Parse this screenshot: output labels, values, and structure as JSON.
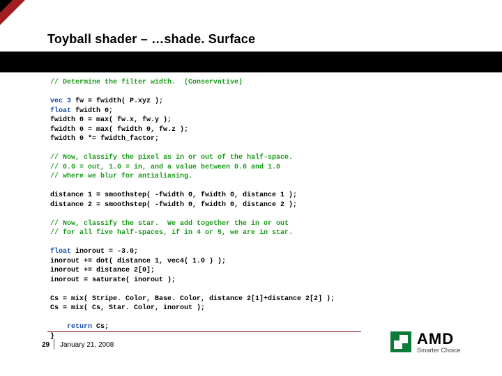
{
  "title": "Toyball shader – …shade. Surface",
  "footer": {
    "page": "29",
    "date": "January 21, 2008"
  },
  "logo": {
    "brand": "AMD",
    "tagline": "Smarter Choice"
  },
  "code": {
    "c1": "// Determine the filter width.  (Conservative)",
    "l1a": "vec 3",
    "l1b": " fw = fwidth( P.xyz );",
    "l2a": "float",
    "l2b": " fwidth 0;",
    "l3": "fwidth 0 = max( fw.x, fw.y );",
    "l4": "fwidth 0 = max( fwidth 0, fw.z );",
    "l5": "fwidth 0 *= fwidth_factor;",
    "c2a": "// Now, classify the pixel as in or out of the half-space.",
    "c2b": "// 0.0 = out, 1.0 = in, and a value between 0.0 and 1.0",
    "c2c": "// where we blur for antialiasing.",
    "l6": "distance 1 = smoothstep( -fwidth 0, fwidth 0, distance 1 );",
    "l7": "distance 2 = smoothstep( -fwidth 0, fwidth 0, distance 2 );",
    "c3a": "// Now, classify the star.  We add together the in or out",
    "c3b": "// for all five half-spaces, if in 4 or 5, we are in star.",
    "l8a": "float",
    "l8b": " inorout = -3.0;",
    "l9": "inorout += dot( distance 1, vec4( 1.0 ) );",
    "l10": "inorout += distance 2[0];",
    "l11": "inorout = saturate( inorout );",
    "l12": "Cs = mix( Stripe. Color, Base. Color, distance 2[1]+distance 2[2] );",
    "l13": "Cs = mix( Cs, Star. Color, inorout );",
    "ret": "    return",
    "retb": " Cs;",
    "brace": "}"
  }
}
